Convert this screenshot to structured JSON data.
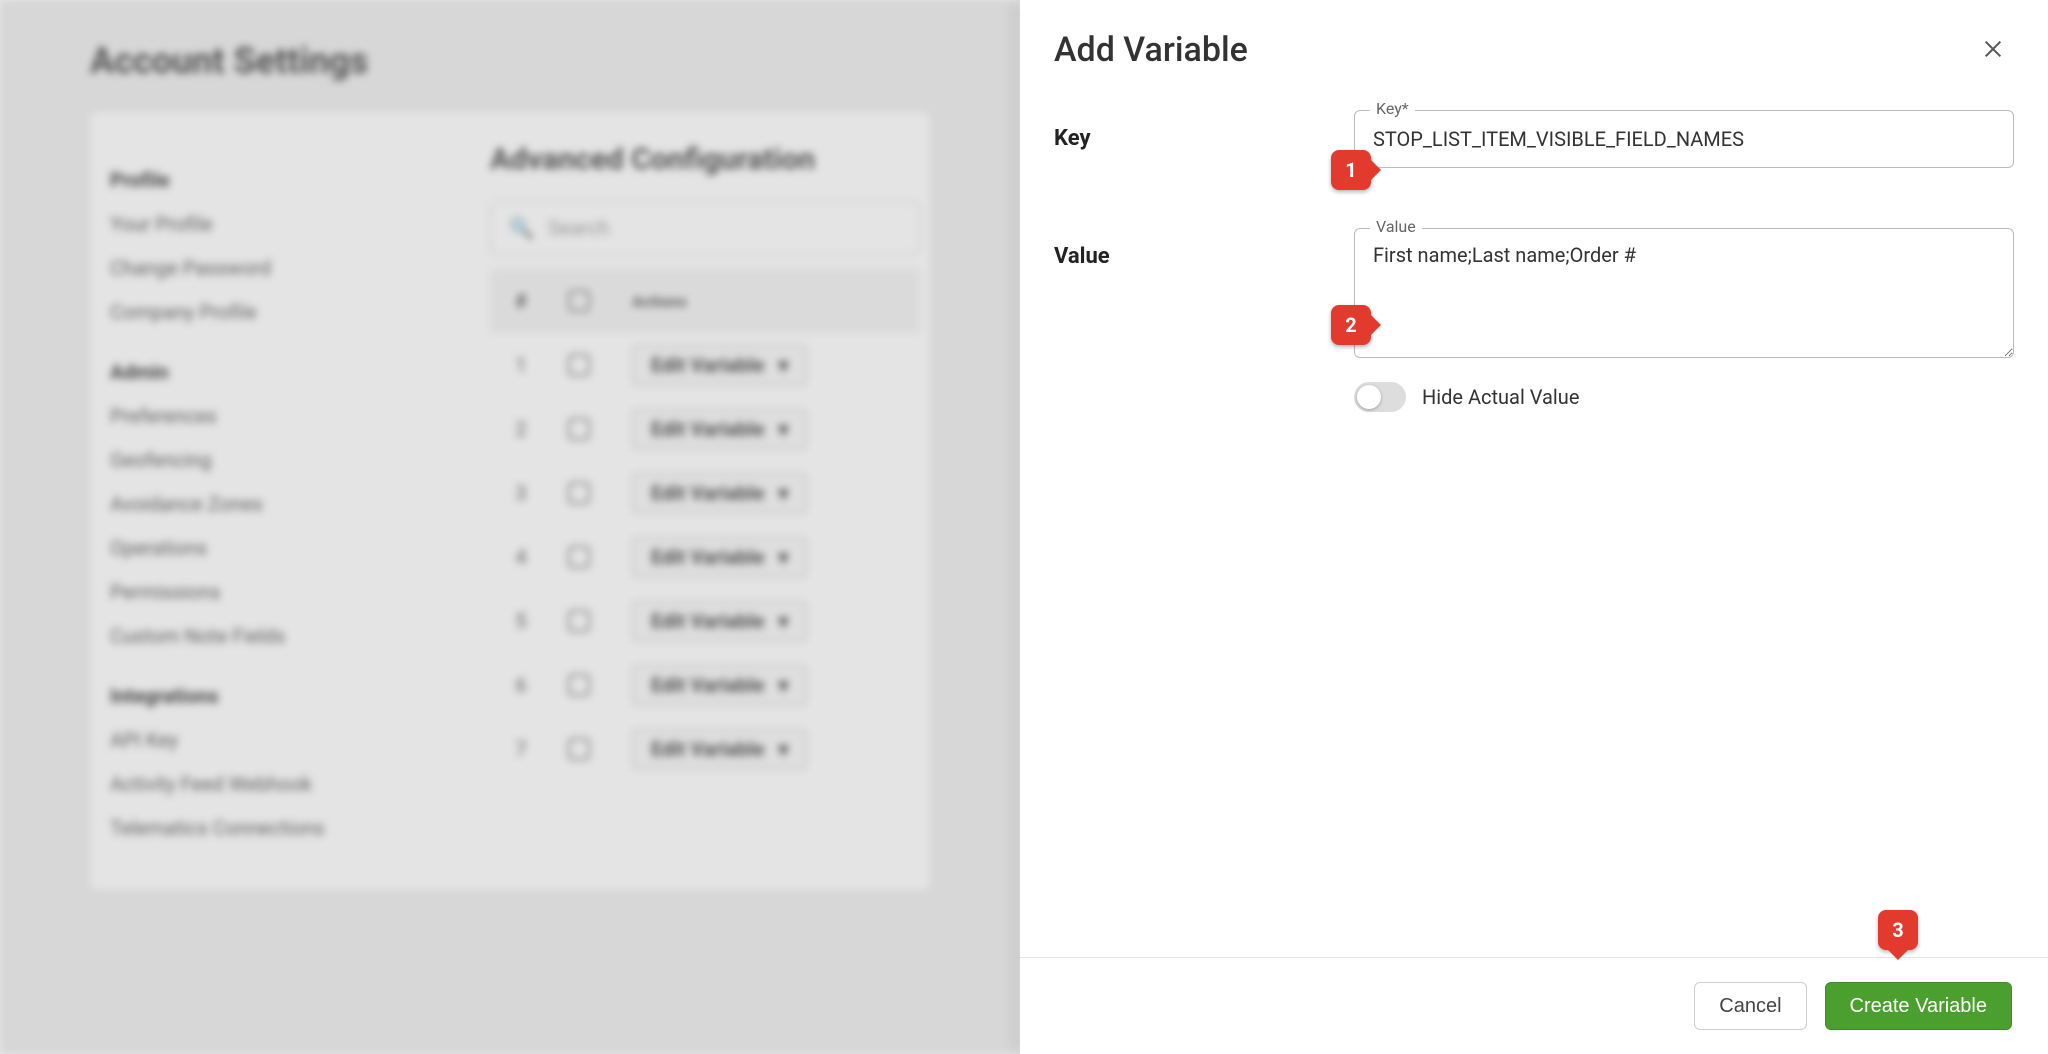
{
  "background": {
    "page_title": "Account Settings",
    "main_heading": "Advanced Configuration",
    "search_placeholder": "Search",
    "nav": {
      "section1_head": "Profile",
      "section1_items": [
        "Your Profile",
        "Change Password",
        "Company Profile"
      ],
      "section2_head": "Admin",
      "section2_items": [
        "Preferences",
        "Geofencing",
        "Avoidance Zones",
        "Operations",
        "Permissions",
        "Custom Note Fields"
      ],
      "section3_head": "Integrations",
      "section3_items": [
        "API Key",
        "Activity Feed Webhook",
        "Telematics Connections"
      ]
    },
    "table": {
      "head_num": "#",
      "head_actions": "Actions",
      "row_button": "Edit Variable",
      "row_count": 7
    }
  },
  "modal": {
    "title": "Add Variable",
    "key_label": "Key",
    "key_float": "Key*",
    "key_value": "STOP_LIST_ITEM_VISIBLE_FIELD_NAMES",
    "value_label": "Value",
    "value_float": "Value",
    "value_value": "First name;Last name;Order #",
    "hide_toggle_label": "Hide Actual Value",
    "cancel_label": "Cancel",
    "create_label": "Create Variable"
  },
  "callouts": {
    "c1": "1",
    "c2": "2",
    "c3": "3"
  }
}
